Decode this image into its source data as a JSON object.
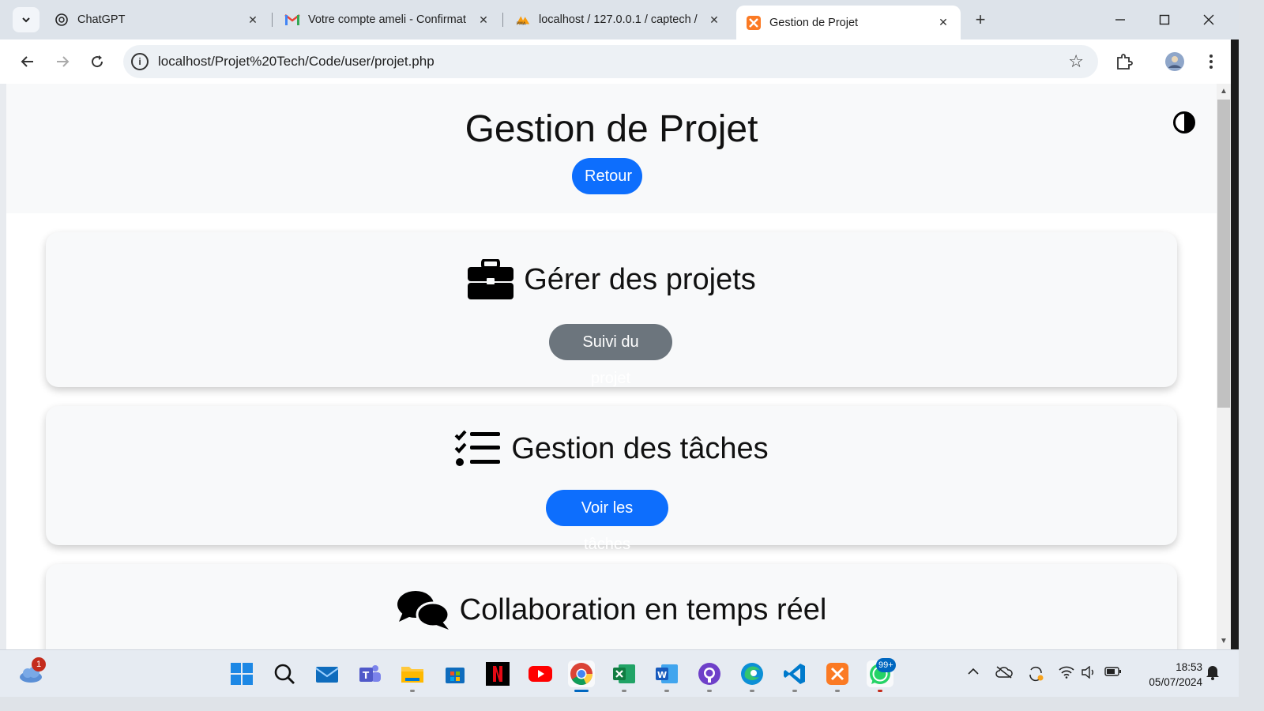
{
  "browser": {
    "tabs": [
      {
        "title": "ChatGPT",
        "icon": "chatgpt-icon"
      },
      {
        "title": "Votre compte ameli - Confirmat",
        "icon": "gmail-icon"
      },
      {
        "title": "localhost / 127.0.0.1 / captech /",
        "icon": "phpmyadmin-icon"
      },
      {
        "title": "Gestion de Projet",
        "icon": "xampp-icon",
        "active": true
      }
    ],
    "url": "localhost/Projet%20Tech/Code/user/projet.php"
  },
  "page": {
    "title": "Gestion de Projet",
    "back_button": "Retour",
    "cards": [
      {
        "title": "Gérer des projets",
        "icon": "briefcase-icon",
        "button": "Suivi du projet"
      },
      {
        "title": "Gestion des tâches",
        "icon": "tasks-icon",
        "button": "Voir les tâches"
      },
      {
        "title": "Collaboration en temps réel",
        "icon": "comments-icon"
      }
    ]
  },
  "taskbar": {
    "weather_badge": "1",
    "whatsapp_badge": "99+",
    "time": "18:53",
    "date": "05/07/2024"
  },
  "colors": {
    "primary": "#0d6efd",
    "secondary": "#6c757d"
  }
}
